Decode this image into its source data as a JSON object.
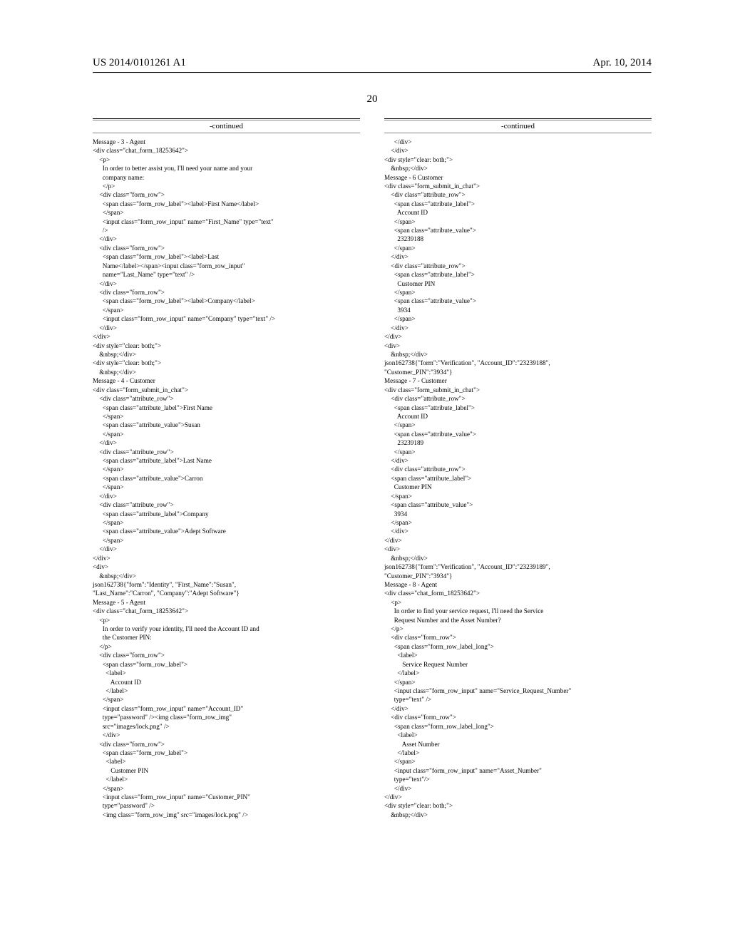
{
  "header": {
    "left": "US 2014/0101261 A1",
    "right": "Apr. 10, 2014"
  },
  "page_number": "20",
  "continued_label": "-continued",
  "col1_lines": [
    "Message - 3 - Agent",
    "<div class=\"chat_form_18253642\">",
    "    <p>",
    "      In order to better assist you, I'll need your name and your",
    "      company name:",
    "      </p>",
    "    <div class=\"form_row\">",
    "      <span class=\"form_row_label\"><label>First Name</label>",
    "      </span>",
    "      <input class=\"form_row_input\" name=\"First_Name\" type=\"text\"",
    "      />",
    "    </div>",
    "    <div class=\"form_row\">",
    "      <span class=\"form_row_label\"><label>Last",
    "      Name</label></span><input class=\"form_row_input\"",
    "      name=\"Last_Name\" type=\"text\" />",
    "    </div>",
    "    <div class=\"form_row\">",
    "      <span class=\"form_row_label\"><label>Company</label>",
    "      </span>",
    "      <input class=\"form_row_input\" name=\"Company\" type=\"text\" />",
    "    </div>",
    "</div>",
    "<div style=\"clear: both;\">",
    "    &nbsp;</div>",
    "<div style=\"clear: both;\">",
    "    &nbsp;</div>",
    "Message - 4 - Customer",
    "<div class=\"form_submit_in_chat\">",
    "    <div class=\"attribute_row\">",
    "      <span class=\"attribute_label\">First Name",
    "      </span>",
    "      <span class=\"attribute_value\">Susan",
    "      </span>",
    "    </div>",
    "    <div class=\"attribute_row\">",
    "      <span class=\"attribute_label\">Last Name",
    "      </span>",
    "      <span class=\"attribute_value\">Carron",
    "      </span>",
    "    </div>",
    "    <div class=\"attribute_row\">",
    "      <span class=\"attribute_label\">Company",
    "      </span>",
    "      <span class=\"attribute_value\">Adept Software",
    "      </span>",
    "    </div>",
    "</div>",
    "<div>",
    "    &nbsp;</div>",
    "json162738{\"form\":\"Identity\", \"First_Name\":\"Susan\",",
    "\"Last_Name\":\"Carron\", \"Company\":\"Adept Software\"}",
    "Message - 5 - Agent",
    "<div class=\"chat_form_18253642\">",
    "    <p>",
    "      In order to verify your identity, I'll need the Account ID and",
    "      the Customer PIN:",
    "    </p>",
    "    <div class=\"form_row\">",
    "      <span class=\"form_row_label\">",
    "        <label>",
    "           Account ID",
    "        </label>",
    "      </span>",
    "      <input class=\"form_row_input\" name=\"Account_ID\"",
    "      type=\"password\" /><img class=\"form_row_img\"",
    "      src=\"images/lock.png\" />",
    "      </div>",
    "    <div class=\"form_row\">",
    "      <span class=\"form_row_label\">",
    "        <label>",
    "           Customer PIN",
    "        </label>",
    "      </span>",
    "      <input class=\"form_row_input\" name=\"Customer_PIN\"",
    "      type=\"password\" />",
    "      <img class=\"form_row_img\" src=\"images/lock.png\" />"
  ],
  "col2_lines": [
    "      </div>",
    "    </div>",
    "<div style=\"clear: both;\">",
    "    &nbsp;</div>",
    "Message - 6 Customer",
    "<div class=\"form_submit_in_chat\">",
    "    <div class=\"attribute_row\">",
    "      <span class=\"attribute_label\">",
    "        Account ID",
    "      </span>",
    "      <span class=\"attribute_value\">",
    "        23239188",
    "      </span>",
    "    </div>",
    "    <div class=\"attribute_row\">",
    "      <span class=\"attribute_label\">",
    "        Customer PIN",
    "      </span>",
    "      <span class=\"attribute_value\">",
    "        3934",
    "      </span>",
    "    </div>",
    "</div>",
    "<div>",
    "    &nbsp;</div>",
    "json162738{\"form\":\"Verification\", \"Account_ID\":\"23239188\",",
    "\"Customer_PIN\":\"3934\"}",
    "Message - 7 - Customer",
    "<div class=\"form_submit_in_chat\">",
    "    <div class=\"attribute_row\">",
    "      <span class=\"attribute_label\">",
    "        Account ID",
    "      </span>",
    "      <span class=\"attribute_value\">",
    "        23239189",
    "      </span>",
    "    </div>",
    "    <div class=\"attribute_row\">",
    "    <span class=\"attribute_label\">",
    "      Customer PIN",
    "    </span>",
    "    <span class=\"attribute_value\">",
    "      3934",
    "    </span>",
    "    </div>",
    "</div>",
    "<div>",
    "    &nbsp;</div>",
    "json162738{\"form\":\"Verification\", \"Account_ID\":\"23239189\",",
    "\"Customer_PIN\":\"3934\"}",
    "Message - 8 - Agent",
    "<div class=\"chat_form_18253642\">",
    "    <p>",
    "      In order to find your service request, I'll need the Service",
    "      Request Number and the Asset Number?",
    "    </p>",
    "    <div class=\"form_row\">",
    "      <span class=\"form_row_label_long\">",
    "        <label>",
    "           Service Request Number",
    "        </label>",
    "      </span>",
    "      <input class=\"form_row_input\" name=\"Service_Request_Number\"",
    "      type=\"text\" />",
    "    </div>",
    "    <div class=\"form_row\">",
    "      <span class=\"form_row_label_long\">",
    "        <label>",
    "           Asset Number",
    "        </label>",
    "      </span>",
    "      <input class=\"form_row_input\" name=\"Asset_Number\"",
    "      type=\"text\"/>",
    "      </div>",
    "</div>",
    "<div style=\"clear: both;\">",
    "    &nbsp;</div>"
  ]
}
